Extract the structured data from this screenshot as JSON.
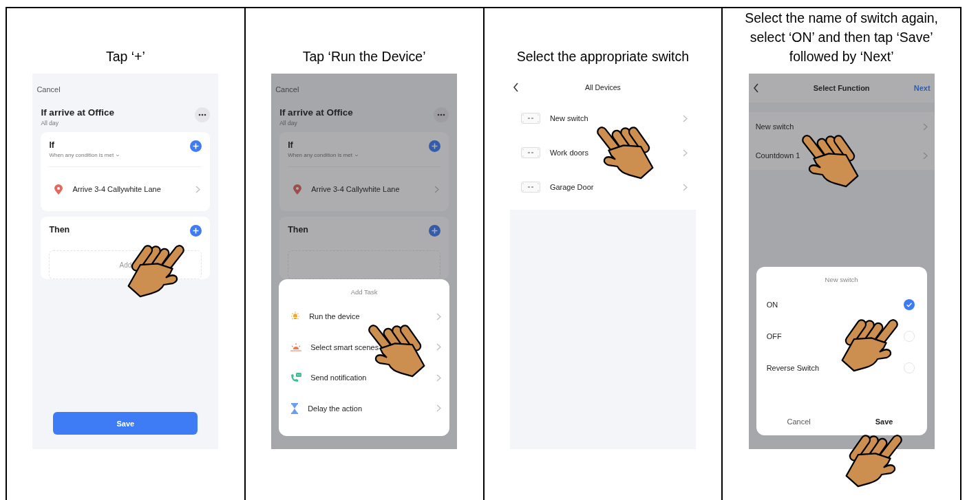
{
  "steps": [
    {
      "caption": "Tap ‘+’",
      "screen": {
        "kind": "rule",
        "dimmed": false,
        "cancel": "Cancel",
        "title": "If arrive at Office",
        "subtitle": "All day",
        "if_card": {
          "title": "If",
          "condition": "When any condition is met",
          "items": [
            {
              "label": "Arrive 3-4 Callywhite Lane",
              "tapped": false
            }
          ],
          "tapped": false
        },
        "then_card": {
          "title": "Then",
          "placeholder": "Add",
          "tapped": true
        },
        "save": "Save"
      }
    },
    {
      "caption": "Tap ‘Run the Device’",
      "screen": {
        "kind": "rule",
        "dimmed": true,
        "cancel": "Cancel",
        "title": "If arrive at Office",
        "subtitle": "All day",
        "if_card": {
          "title": "If",
          "condition": "When any condition is met",
          "items": [
            {
              "label": "Arrive 3-4 Callywhite Lane",
              "tapped": false
            }
          ],
          "tapped": false
        },
        "then_card": {
          "title": "Then",
          "tapped": false
        },
        "sheet": {
          "title": "Add Task",
          "items": [
            {
              "kind": "device",
              "label": "Run the device",
              "tapped": true
            },
            {
              "kind": "scene",
              "label": "Select smart scenes",
              "tapped": false
            },
            {
              "kind": "notification",
              "label": "Send notification",
              "tapped": false
            },
            {
              "kind": "delay",
              "label": "Delay the action",
              "tapped": false
            }
          ]
        }
      }
    },
    {
      "caption": "Select the appropriate switch",
      "screen": {
        "kind": "device_list",
        "title": "All Devices",
        "items": [
          {
            "label": "New switch",
            "tapped": true
          },
          {
            "label": "Work doors",
            "tapped": false
          },
          {
            "label": "Garage Door",
            "tapped": false
          }
        ]
      }
    },
    {
      "caption": "Select the name of switch again, select ‘ON’ and then tap ‘Save’ followed by ‘Next’",
      "screen": {
        "kind": "function",
        "dimmed": true,
        "title": "Select Function",
        "next": "Next",
        "items": [
          {
            "label": "New switch",
            "tapped": true
          },
          {
            "label": "Countdown 1",
            "tapped": false
          }
        ],
        "dialog": {
          "title": "New switch",
          "options": [
            {
              "label": "ON",
              "selected": true,
              "tapped": true
            },
            {
              "label": "OFF",
              "selected": false,
              "tapped": false
            },
            {
              "label": "Reverse Switch",
              "selected": false,
              "tapped": false
            }
          ],
          "cancel": "Cancel",
          "save": "Save",
          "save_tapped": true
        }
      }
    }
  ]
}
